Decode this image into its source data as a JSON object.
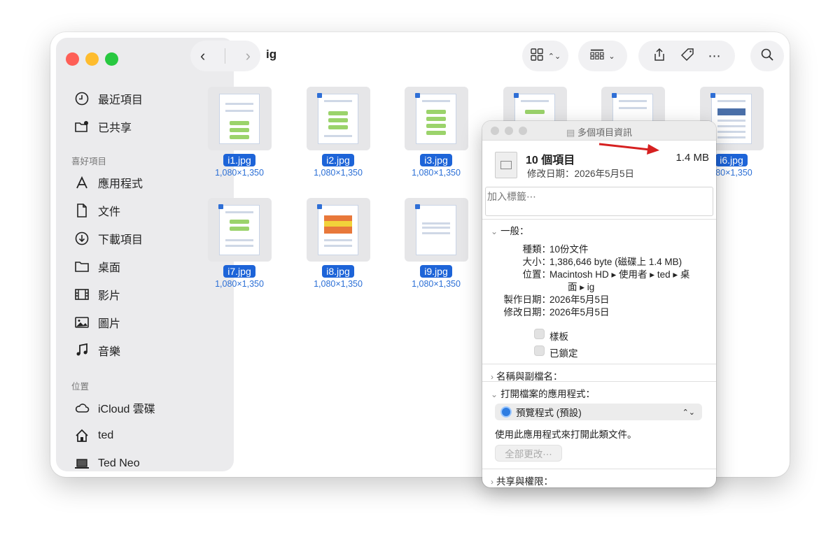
{
  "toolbar": {
    "folder": "ig",
    "back": "‹",
    "forward": "›"
  },
  "sidebar": {
    "recents": [
      {
        "label": "最近項目"
      },
      {
        "label": "已共享"
      }
    ],
    "favorites_title": "喜好項目",
    "favorites": [
      {
        "label": "應用程式"
      },
      {
        "label": "文件"
      },
      {
        "label": "下載項目"
      },
      {
        "label": "桌面"
      },
      {
        "label": "影片"
      },
      {
        "label": "圖片"
      },
      {
        "label": "音樂"
      }
    ],
    "locations_title": "位置",
    "locations": [
      {
        "label": "iCloud 雲碟"
      },
      {
        "label": "ted"
      },
      {
        "label": "Ted Neo"
      }
    ]
  },
  "files": [
    {
      "name": "i1.jpg",
      "dims": "1,080×1,350"
    },
    {
      "name": "i2.jpg",
      "dims": "1,080×1,350"
    },
    {
      "name": "i3.jpg",
      "dims": "1,080×1,350"
    },
    {
      "name": "i6.jpg",
      "dims": "080×1,350"
    },
    {
      "name": "i7.jpg",
      "dims": "1,080×1,350"
    },
    {
      "name": "i8.jpg",
      "dims": "1,080×1,350"
    },
    {
      "name": "i9.jpg",
      "dims": "1,080×1,350"
    }
  ],
  "info": {
    "window_title": "多個項目資訊",
    "item_count": "10 個項目",
    "size": "1.4 MB",
    "modified": "修改日期：2026年5月5日",
    "tags_placeholder": "加入標籤⋯",
    "general": {
      "header": "一般：",
      "kind_label": "種類：",
      "kind": "10份文件",
      "size_label": "大小：",
      "size": "1,386,646 byte (磁碟上 1.4 MB)",
      "where_label": "位置：",
      "where_line1": "Macintosh HD ▸ 使用者 ▸ ted ▸ 桌",
      "where_line2": "面 ▸ ig",
      "created_label": "製作日期：",
      "created": "2026年5月5日",
      "modified_label": "修改日期：",
      "modified": "2026年5月5日",
      "stationery": "樣板",
      "locked": "已鎖定"
    },
    "name_ext": "名稱與副檔名：",
    "open_with": "打開檔案的應用程式：",
    "app": "預覽程式 (預設)",
    "use_app_text": "使用此應用程式來打開此類文件。",
    "change_all": "全部更改⋯",
    "sharing": "共享與權限："
  }
}
